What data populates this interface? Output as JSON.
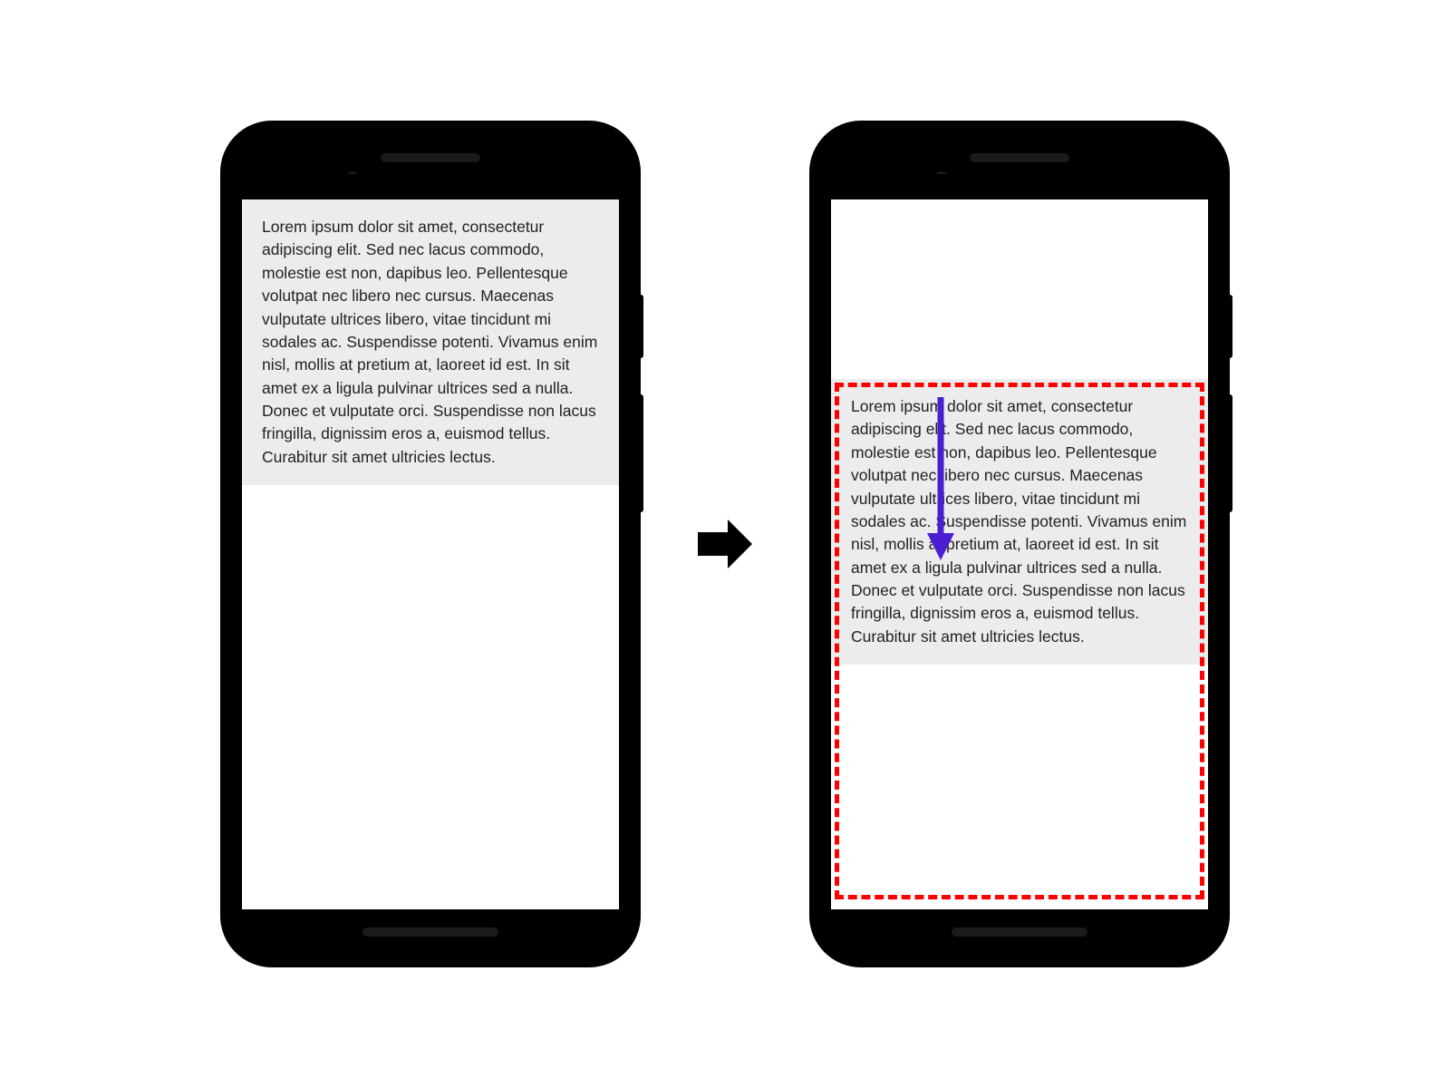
{
  "textContent": "Lorem ipsum dolor sit amet, consectetur adipiscing elit. Sed nec lacus commodo, molestie est non, dapibus leo. Pellentesque volutpat nec libero nec cursus. Maecenas vulputate ultrices libero, vitae tincidunt mi sodales ac. Suspendisse potenti. Vivamus enim nisl, mollis at pretium at, laoreet id est. In sit amet ex a ligula pulvinar ultrices sed a nulla. Donec et vulputate orci. Suspendisse non lacus fringilla, dignissim eros a, euismod tellus. Curabitur sit amet ultricies lectus.",
  "colors": {
    "highlightBorder": "#ff0000",
    "arrow": "#4b1ed4",
    "textBackground": "#ececec"
  }
}
